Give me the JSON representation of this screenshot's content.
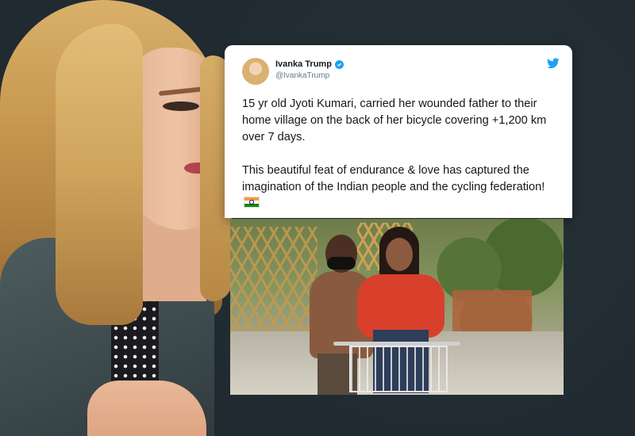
{
  "tweet": {
    "author_name": "Ivanka Trump",
    "author_handle": "@IvankaTrump",
    "verified": true,
    "paragraph1": "15 yr old Jyoti Kumari, carried her wounded father to their home village on the back of her bicycle covering +1,200 km over 7 days.",
    "paragraph2": "This beautiful feat of endurance & love has captured the imagination of the Indian people and the cycling federation!",
    "paragraph2_emoji": "india-flag-icon"
  },
  "colors": {
    "background": "#1f2a31",
    "twitter_blue": "#1da1f2",
    "text": "#14171a",
    "handle_gray": "#657786"
  },
  "icons": {
    "brand": "twitter-bird-icon",
    "verified": "verified-badge-icon",
    "flag": "india-flag-icon"
  }
}
